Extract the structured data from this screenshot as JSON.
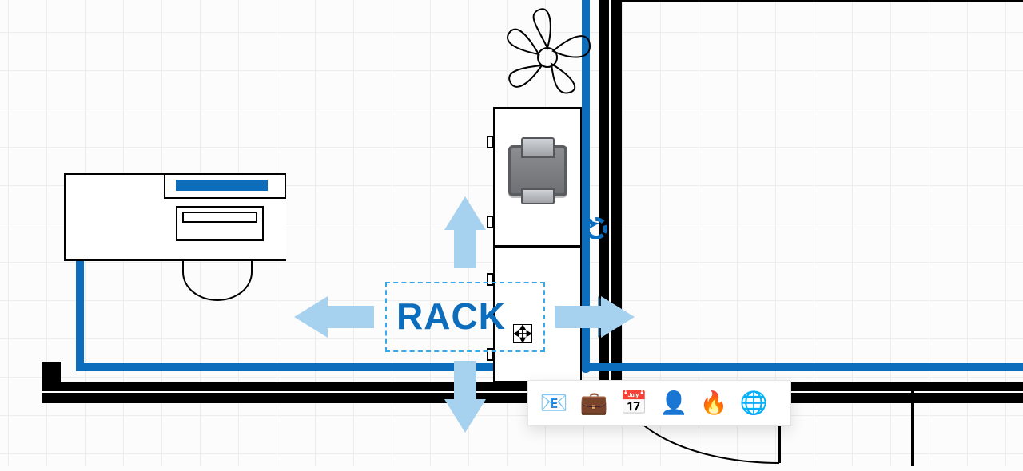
{
  "selection": {
    "label": "RACK"
  },
  "tagbar": {
    "items": [
      {
        "name": "email",
        "glyph": "📧"
      },
      {
        "name": "work",
        "glyph": "💼"
      },
      {
        "name": "calendar",
        "glyph": "📅"
      },
      {
        "name": "person",
        "glyph": "👤"
      },
      {
        "name": "fire",
        "glyph": "🔥"
      },
      {
        "name": "globe",
        "glyph": "🌐"
      }
    ]
  }
}
